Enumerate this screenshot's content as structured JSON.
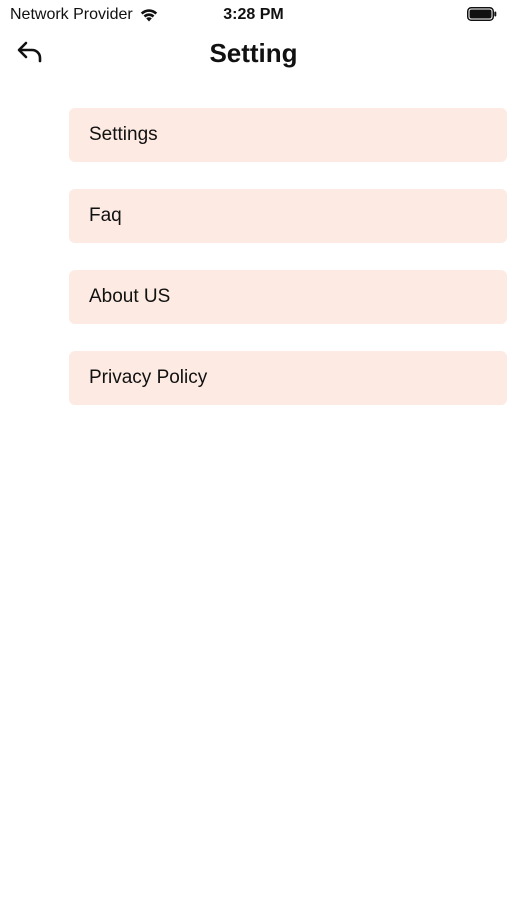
{
  "status_bar": {
    "carrier": "Network Provider",
    "time": "3:28 PM",
    "wifi_icon": "wifi-icon",
    "battery_icon": "battery-icon"
  },
  "header": {
    "title": "Setting",
    "back_icon": "back-arrow-icon"
  },
  "menu": {
    "items": [
      {
        "label": "Settings"
      },
      {
        "label": "Faq"
      },
      {
        "label": "About US"
      },
      {
        "label": "Privacy Policy"
      }
    ]
  },
  "colors": {
    "menu_item_bg": "#fdebe3",
    "text": "#111111",
    "background": "#ffffff"
  }
}
